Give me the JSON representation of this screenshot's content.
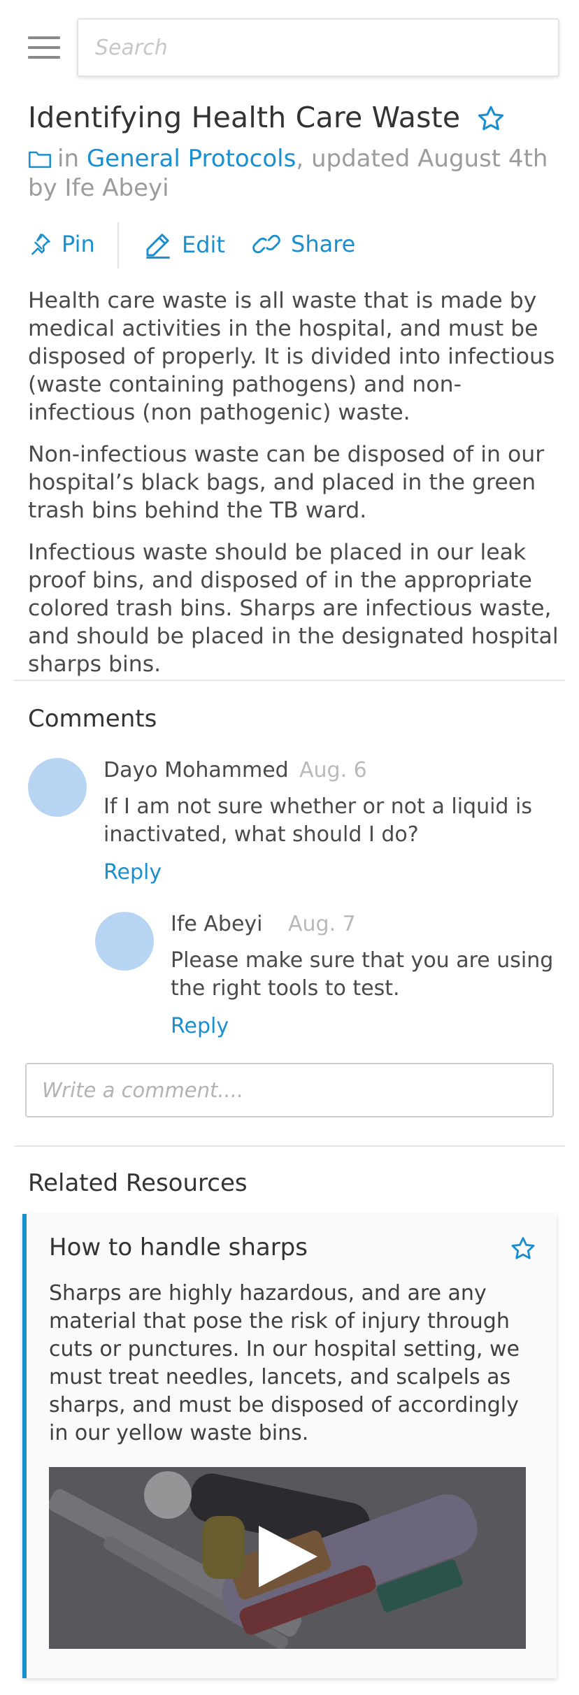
{
  "header": {
    "search_placeholder": "Search"
  },
  "article": {
    "title": "Identifying Health Care Waste",
    "meta_prefix": "in ",
    "category": "General Protocols",
    "meta_suffix": ", updated August 4th by Ife Abeyi",
    "actions": {
      "pin": "Pin",
      "edit": "Edit",
      "share": "Share"
    },
    "paragraphs": [
      "Health care waste is all waste that is made by medical activities in the hospital, and must be disposed of properly. It is divided into infectious (waste containing pathogens) and non-infectious (non pathogenic) waste.",
      "Non-infectious waste can be disposed of in our hospital’s black bags, and placed in the green trash bins behind the TB ward.",
      "Infectious waste should be placed in our leak proof bins, and disposed of in the appropriate colored trash bins. Sharps are infectious waste, and should be placed in the designated hospital sharps bins."
    ]
  },
  "comments": {
    "heading": "Comments",
    "items": [
      {
        "author": "Dayo Mohammed",
        "date": "Aug. 6",
        "text": "If I am not sure whether or not a liquid is inactivated, what should I do?",
        "reply": "Reply"
      },
      {
        "author": "Ife Abeyi",
        "date": "Aug. 7",
        "text": "Please make sure that you are using the right tools to test.",
        "reply": "Reply"
      }
    ],
    "input_placeholder": "Write a comment...."
  },
  "related": {
    "heading": "Related Resources",
    "card": {
      "title": "How to handle sharps",
      "text": "Sharps are highly hazardous, and are any material that pose the risk of injury through cuts or punctures. In our hospital setting, we must treat needles, lancets, and scalpels as sharps, and must be disposed of accordingly in our yellow waste bins."
    }
  },
  "colors": {
    "accent": "#1a8fd0",
    "avatar": "#b8d4f3",
    "muted": "#9c9c9c"
  },
  "icons": [
    "hamburger-menu-icon",
    "star-icon",
    "folder-icon",
    "pin-icon",
    "pencil-icon",
    "link-icon",
    "play-icon"
  ]
}
